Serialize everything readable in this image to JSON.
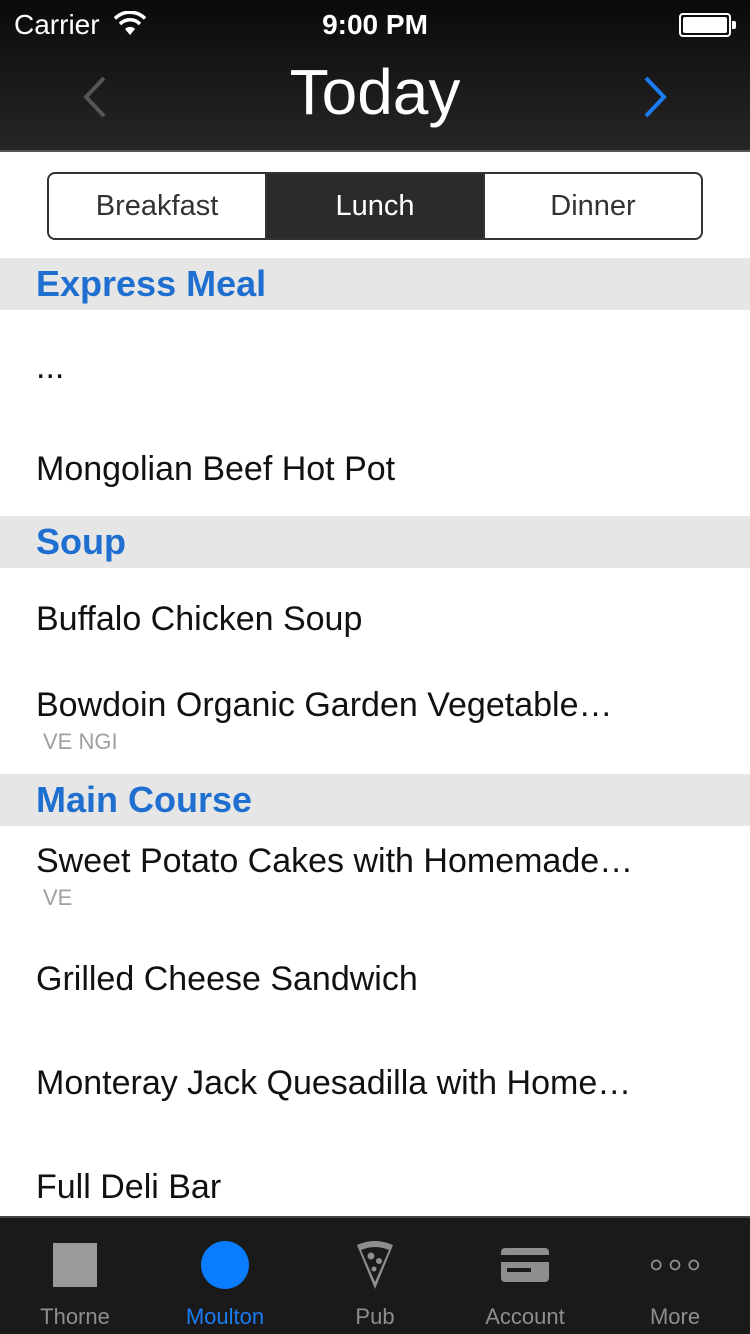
{
  "status_bar": {
    "carrier": "Carrier",
    "time": "9:00 PM"
  },
  "nav": {
    "title": "Today",
    "prev_icon": "chevron-left-icon",
    "next_icon": "chevron-right-icon"
  },
  "meal_tabs": {
    "items": [
      "Breakfast",
      "Lunch",
      "Dinner"
    ],
    "selected": "Lunch"
  },
  "sections": [
    {
      "title": "Express Meal",
      "items": [
        {
          "name": "...",
          "tags": ""
        },
        {
          "name": "Mongolian Beef Hot Pot",
          "tags": ""
        }
      ]
    },
    {
      "title": "Soup",
      "items": [
        {
          "name": "Buffalo Chicken Soup",
          "tags": ""
        },
        {
          "name": "Bowdoin Organic Garden Vegetable…",
          "tags": "VE NGI"
        }
      ]
    },
    {
      "title": "Main Course",
      "items": [
        {
          "name": "Sweet Potato Cakes with Homemade…",
          "tags": "VE"
        },
        {
          "name": "Grilled Cheese Sandwich",
          "tags": ""
        },
        {
          "name": "Monteray Jack Quesadilla with Home…",
          "tags": ""
        },
        {
          "name": "Full Deli Bar",
          "tags": ""
        }
      ]
    }
  ],
  "tabbar": {
    "items": [
      {
        "label": "Thorne",
        "icon": "square-icon"
      },
      {
        "label": "Moulton",
        "icon": "circle-icon"
      },
      {
        "label": "Pub",
        "icon": "pizza-icon"
      },
      {
        "label": "Account",
        "icon": "credit-card-icon"
      },
      {
        "label": "More",
        "icon": "more-dots-icon"
      }
    ],
    "selected": "Moulton"
  },
  "colors": {
    "accent": "#1f6fd1",
    "tab_active": "#1a7cf2",
    "header_bg": "#1a1a1a",
    "section_bg": "#e6e6e6"
  }
}
